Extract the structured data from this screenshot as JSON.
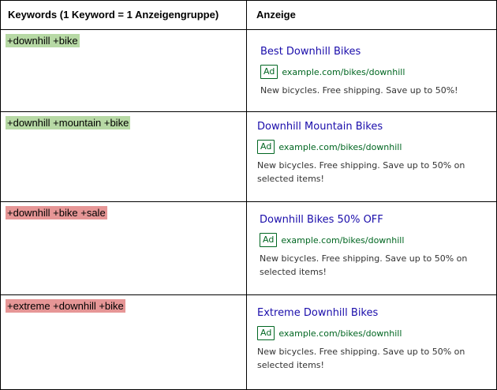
{
  "table": {
    "header_keywords": "Keywords (1 Keyword = 1 Anzeigengruppe)",
    "header_ad": "Anzeige"
  },
  "rows": [
    {
      "keyword": "+downhill +bike",
      "keyword_color": "#b7d9a5",
      "ad": {
        "title": "Best Downhill Bikes",
        "badge": "Ad",
        "url": "example.com/bikes/downhill",
        "description": "New bicycles. Free shipping. Save up to 50%!"
      }
    },
    {
      "keyword": "+downhill +mountain +bike",
      "keyword_color": "#b7d9a5",
      "ad": {
        "title": "Downhill Mountain Bikes",
        "badge": "Ad",
        "url": "example.com/bikes/downhill",
        "description": "New bicycles. Free shipping. Save up to 50% on selected items!"
      }
    },
    {
      "keyword": "+downhill +bike +sale",
      "keyword_color": "#e69696",
      "ad": {
        "title": "Downhill Bikes 50% OFF",
        "badge": "Ad",
        "url": "example.com/bikes/downhill",
        "description": "New bicycles. Free shipping. Save up to 50% on selected items!"
      }
    },
    {
      "keyword": "+extreme +downhill +bike",
      "keyword_color": "#e69696",
      "ad": {
        "title": "Extreme Downhill Bikes",
        "badge": "Ad",
        "url": "example.com/bikes/downhill",
        "description": "New bicycles. Free shipping. Save up to 50% on selected items!"
      }
    }
  ]
}
